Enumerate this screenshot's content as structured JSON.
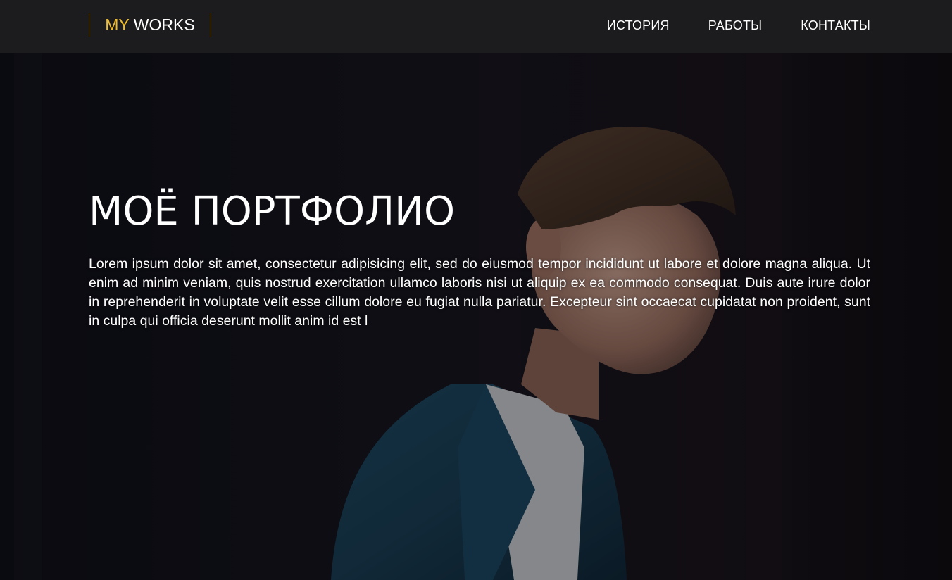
{
  "header": {
    "logo": {
      "part1": "MY",
      "part2": "WORKS"
    },
    "nav": [
      "ИСТОРИЯ",
      "РАБОТЫ",
      "КОНТАКТЫ"
    ]
  },
  "hero": {
    "title": "МОЁ ПОРТФОЛИО",
    "text": "Lorem ipsum dolor sit amet, consectetur adipisicing elit, sed do eiusmod tempor incididunt ut labore et dolore magna aliqua. Ut enim ad minim veniam, quis nostrud exercitation ullamco laboris nisi ut aliquip ex ea commodo consequat. Duis aute irure dolor in reprehenderit in voluptate velit esse cillum dolore eu fugiat nulla pariatur. Excepteur sint occaecat cupidatat non proident, sunt in culpa qui officia deserunt mollit anim id est l"
  },
  "colors": {
    "accent": "#f0bc2a",
    "header_bg": "#1c1c1e",
    "hero_bg": "#0e0f16",
    "text": "#ffffff"
  }
}
